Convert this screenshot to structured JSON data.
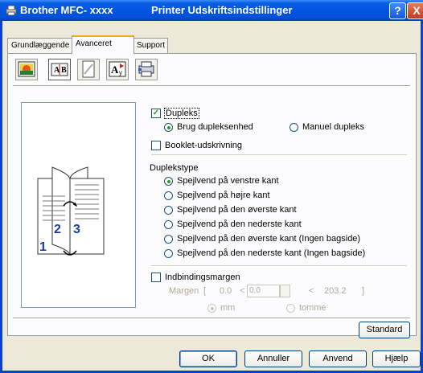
{
  "window": {
    "app_title": "Brother MFC- xxxx",
    "dialog_title": "Printer Udskriftsindstillinger",
    "help_glyph": "?",
    "close_glyph": "X"
  },
  "tabs": [
    {
      "label": "Grundlæggende"
    },
    {
      "label": "Avanceret",
      "active": true
    },
    {
      "label": "Support"
    }
  ],
  "toolbar_icons": [
    "color-icon",
    "scaling-icon",
    "watermark-icon",
    "print-settings-icon",
    "device-options-icon"
  ],
  "duplex": {
    "checkbox_label": "Dupleks",
    "checked": true,
    "use_unit_label": "Brug dupleksenhed",
    "manual_label": "Manuel dupleks",
    "selected": "use_unit"
  },
  "booklet": {
    "label": "Booklet-udskrivning",
    "checked": false
  },
  "duplex_type": {
    "heading": "Duplekstype",
    "options": [
      "Spejlvend på venstre kant",
      "Spejlvend på højre kant",
      "Spejlvend på den øverste kant",
      "Spejlvend på den nederste kant",
      "Spejlvend på den øverste kant (Ingen bagside)",
      "Spejlvend på den nederste kant (Ingen bagside)"
    ],
    "selected_index": 0
  },
  "binding": {
    "label": "Indbindingsmargen",
    "checked": false,
    "margin_label": "Margen",
    "bracket_open": "[",
    "min": "0.0",
    "lt1": "<",
    "value": "0.0",
    "lt2": "<",
    "max": "203.2",
    "bracket_close": "]",
    "unit_mm": "mm",
    "unit_inch": "tomme",
    "selected_unit": "mm"
  },
  "preview": {
    "page_numbers": [
      "1",
      "2",
      "3"
    ]
  },
  "buttons": {
    "standard": "Standard",
    "ok": "OK",
    "cancel": "Annuller",
    "apply": "Anvend",
    "help": "Hjælp"
  },
  "colors": {
    "titlebar": "#0054e3",
    "accent": "#21a121",
    "tab_highlight": "#f5a623"
  }
}
